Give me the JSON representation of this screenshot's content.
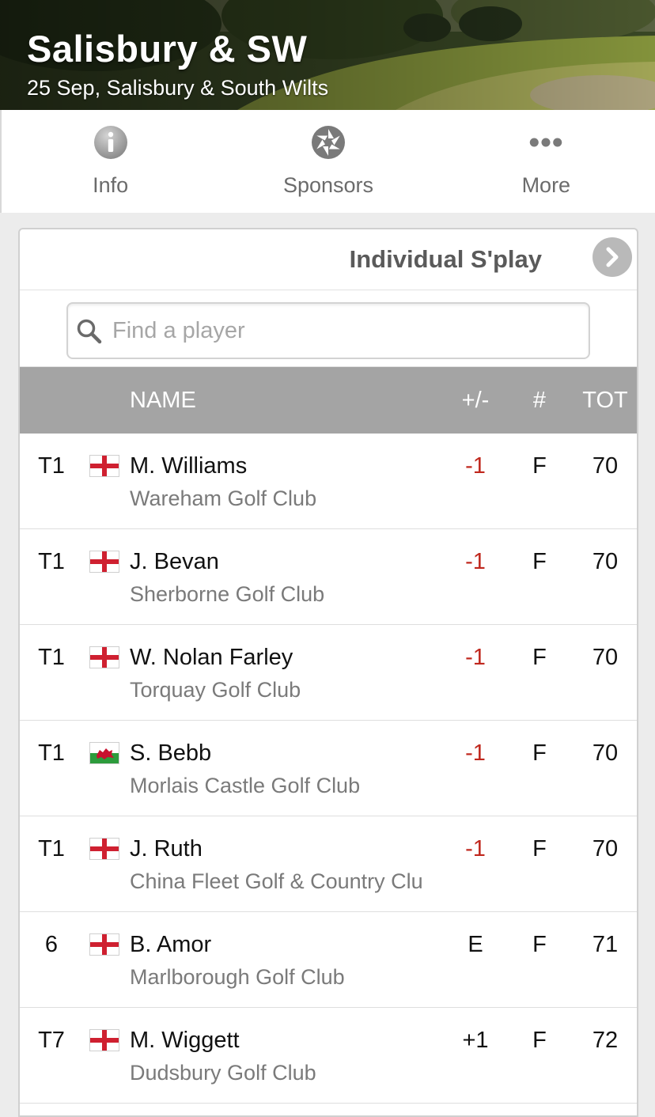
{
  "colors": {
    "under_par": "#c0281e",
    "even_or_over": "#111111",
    "header_bar": "#a4a4a4"
  },
  "banner": {
    "title": "Salisbury & SW",
    "subtitle": "25 Sep, Salisbury & South Wilts"
  },
  "nav": {
    "items": [
      {
        "label": "Info",
        "icon": "info-icon"
      },
      {
        "label": "Sponsors",
        "icon": "aperture-icon"
      },
      {
        "label": "More",
        "icon": "ellipsis-icon"
      }
    ]
  },
  "card": {
    "title": "Individual S'play",
    "next_icon": "chevron-right-icon"
  },
  "search": {
    "placeholder": "Find a player",
    "value": ""
  },
  "table": {
    "headers": {
      "name": "NAME",
      "plus_minus": "+/-",
      "thru": "#",
      "total": "TOT"
    },
    "rows": [
      {
        "pos": "T1",
        "flag": "england",
        "name": "M. Williams",
        "club": "Wareham Golf Club",
        "plus_minus": "-1",
        "thru": "F",
        "total": "70"
      },
      {
        "pos": "T1",
        "flag": "england",
        "name": "J. Bevan",
        "club": "Sherborne Golf Club",
        "plus_minus": "-1",
        "thru": "F",
        "total": "70"
      },
      {
        "pos": "T1",
        "flag": "england",
        "name": "W. Nolan Farley",
        "club": "Torquay Golf Club",
        "plus_minus": "-1",
        "thru": "F",
        "total": "70"
      },
      {
        "pos": "T1",
        "flag": "wales",
        "name": "S. Bebb",
        "club": "Morlais Castle Golf Club",
        "plus_minus": "-1",
        "thru": "F",
        "total": "70"
      },
      {
        "pos": "T1",
        "flag": "england",
        "name": "J. Ruth",
        "club": "China Fleet Golf & Country Clu",
        "plus_minus": "-1",
        "thru": "F",
        "total": "70"
      },
      {
        "pos": "6",
        "flag": "england",
        "name": "B. Amor",
        "club": "Marlborough Golf Club",
        "plus_minus": "E",
        "thru": "F",
        "total": "71"
      },
      {
        "pos": "T7",
        "flag": "england",
        "name": "M. Wiggett",
        "club": "Dudsbury Golf Club",
        "plus_minus": "+1",
        "thru": "F",
        "total": "72"
      }
    ]
  }
}
